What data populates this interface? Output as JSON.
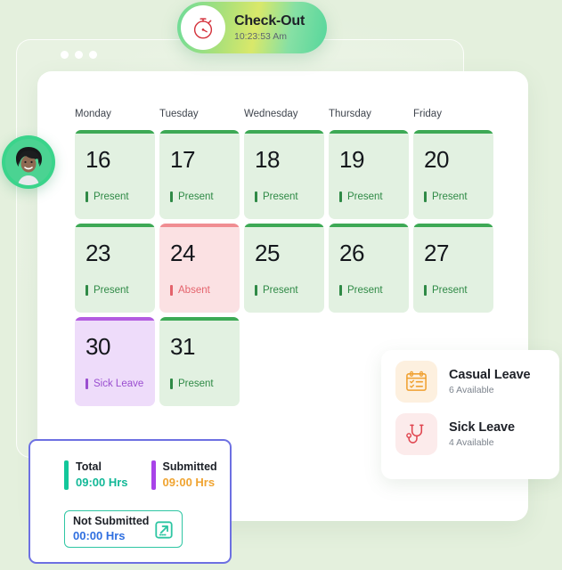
{
  "checkout": {
    "title": "Check-Out",
    "time": "10:23:53 Am",
    "icon": "stopwatch-icon"
  },
  "calendar": {
    "day_headers": [
      "Monday",
      "Tuesday",
      "Wednesday",
      "Thursday",
      "Friday"
    ],
    "days": [
      {
        "date": "16",
        "status": "Present",
        "theme": "present"
      },
      {
        "date": "17",
        "status": "Present",
        "theme": "present"
      },
      {
        "date": "18",
        "status": "Present",
        "theme": "present"
      },
      {
        "date": "19",
        "status": "Present",
        "theme": "present"
      },
      {
        "date": "20",
        "status": "Present",
        "theme": "present"
      },
      {
        "date": "23",
        "status": "Present",
        "theme": "present"
      },
      {
        "date": "24",
        "status": "Absent",
        "theme": "absent"
      },
      {
        "date": "25",
        "status": "Present",
        "theme": "present"
      },
      {
        "date": "26",
        "status": "Present",
        "theme": "present"
      },
      {
        "date": "27",
        "status": "Present",
        "theme": "present"
      },
      {
        "date": "30",
        "status": "Sick Leave",
        "theme": "sick"
      },
      {
        "date": "31",
        "status": "Present",
        "theme": "present"
      }
    ]
  },
  "leave_panel": {
    "items": [
      {
        "name": "Casual Leave",
        "available": "6 Available",
        "icon": "calendar-checklist-icon"
      },
      {
        "name": "Sick Leave",
        "available": "4 Available",
        "icon": "stethoscope-icon"
      }
    ]
  },
  "summary": {
    "total_label": "Total",
    "total_value": "09:00 Hrs",
    "submitted_label": "Submitted",
    "submitted_value": "09:00 Hrs",
    "not_submitted_label": "Not Submitted",
    "not_submitted_value": "00:00 Hrs",
    "export_icon": "export-external-link-icon"
  },
  "colors": {
    "background": "#e4f0dd",
    "present_bar": "#3da955",
    "present_bg": "#e2f1e1",
    "absent_bar": "#f08d92",
    "absent_bg": "#fbe1e3",
    "sick_bar": "#b35ce0",
    "sick_bg": "#eedcfa",
    "summary_border": "#6d70e2",
    "total_accent": "#12c79a",
    "submitted_accent": "#a843e8",
    "submitted_value_color": "#f0a431",
    "not_submitted_value_color": "#2f6fe0",
    "casual_leave_accent": "#f0a030",
    "sick_leave_accent": "#e0454f"
  },
  "avatar": {
    "alt": "employee-avatar"
  }
}
